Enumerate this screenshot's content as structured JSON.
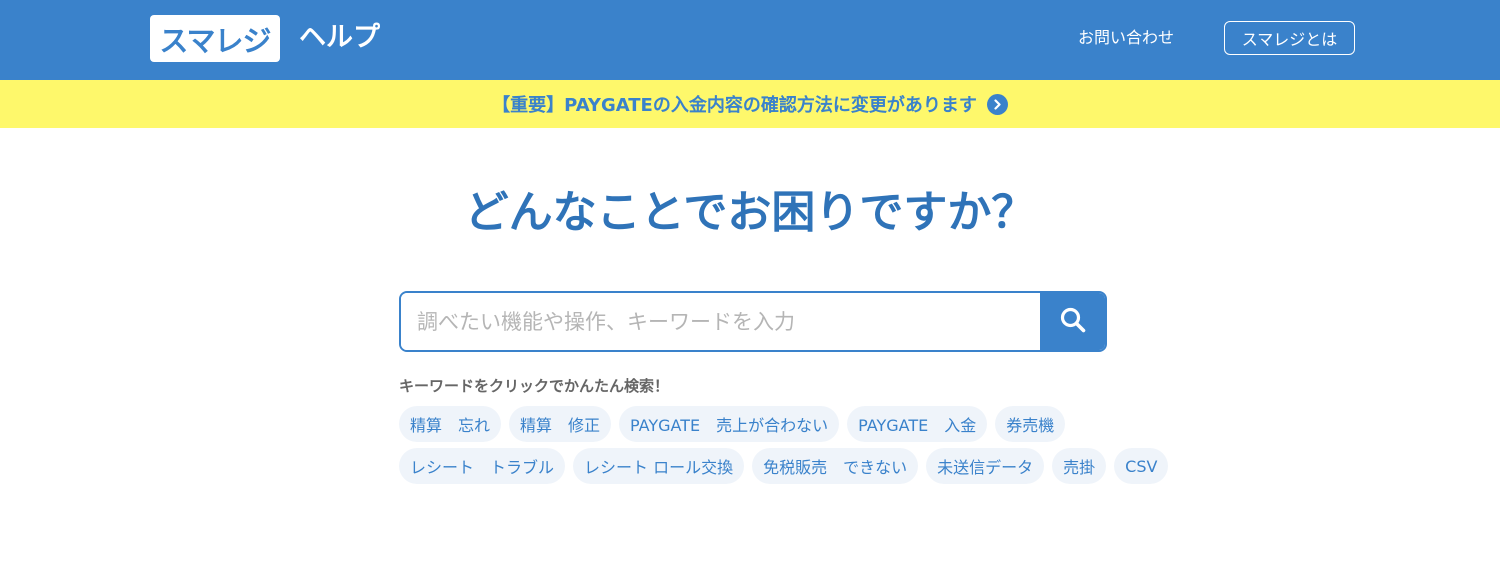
{
  "header": {
    "logo_text": "スマレジ",
    "logo_subtitle": "ヘルプ",
    "contact_label": "お問い合わせ",
    "about_label": "スマレジとは"
  },
  "notice": {
    "text": "【重要】PAYGATEの入金内容の確認方法に変更があります",
    "icon": "chevron-right-circle-icon"
  },
  "hero": {
    "title": "どんなことでお困りですか？"
  },
  "search": {
    "placeholder": "調べたい機能や操作、キーワードを入力",
    "value": "",
    "button_icon": "search-icon"
  },
  "keywords": {
    "heading": "キーワードをクリックでかんたん検索！",
    "items": [
      "精算　忘れ",
      "精算　修正",
      "PAYGATE　売上が合わない",
      "PAYGATE　入金",
      "券売機",
      "レシート　トラブル",
      "レシート ロール交換",
      "免税販売　できない",
      "未送信データ",
      "売掛",
      "CSV"
    ]
  },
  "colors": {
    "brand_blue": "#3a82cb",
    "notice_yellow": "#fef86b",
    "chip_bg": "#eff4fa"
  }
}
